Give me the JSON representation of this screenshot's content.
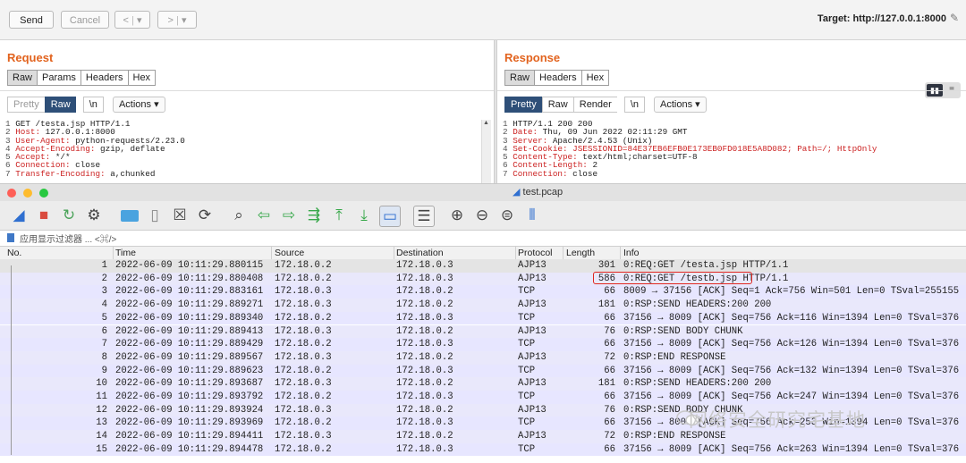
{
  "burp": {
    "buttons": {
      "send": "Send",
      "cancel": "Cancel",
      "back": "<",
      "forward": ">",
      "dropdown": "▾"
    },
    "target_label": "Target: http://127.0.0.1:8000",
    "request": {
      "title": "Request",
      "tabs": [
        "Raw",
        "Params",
        "Headers",
        "Hex"
      ],
      "subtabs": {
        "pretty": "Pretty",
        "raw": "Raw",
        "newline": "\\n",
        "actions": "Actions ▾"
      },
      "lines": [
        {
          "n": "1",
          "k": "",
          "v": "GET /testa.jsp HTTP/1.1"
        },
        {
          "n": "2",
          "k": "Host:",
          "v": " 127.0.0.1:8000"
        },
        {
          "n": "3",
          "k": "User-Agent:",
          "v": " python-requests/2.23.0"
        },
        {
          "n": "4",
          "k": "Accept-Encoding:",
          "v": " gzip, deflate"
        },
        {
          "n": "5",
          "k": "Accept:",
          "v": " */*"
        },
        {
          "n": "6",
          "k": "Connection:",
          "v": " close"
        },
        {
          "n": "7",
          "k": "Transfer-Encoding:",
          "v": " a,chunked"
        }
      ]
    },
    "response": {
      "title": "Response",
      "tabs": [
        "Raw",
        "Headers",
        "Hex"
      ],
      "subtabs": {
        "pretty": "Pretty",
        "raw": "Raw",
        "render": "Render",
        "newline": "\\n",
        "actions": "Actions ▾"
      },
      "lines": [
        {
          "n": "1",
          "k": "",
          "v": "HTTP/1.1 200 200"
        },
        {
          "n": "2",
          "k": "Date:",
          "v": " Thu, 09 Jun 2022 02:11:29 GMT"
        },
        {
          "n": "3",
          "k": "Server:",
          "v": " Apache/2.4.53 (Unix)"
        },
        {
          "n": "4",
          "k": "Set-Cookie:",
          "v": " JSESSIONID=84E37EB6EFB0E173EB0FD018E5A8D082; Path=/; HttpOnly"
        },
        {
          "n": "5",
          "k": "Content-Type:",
          "v": " text/html;charset=UTF-8"
        },
        {
          "n": "6",
          "k": "Content-Length:",
          "v": " 2"
        },
        {
          "n": "7",
          "k": "Connection:",
          "v": " close"
        }
      ]
    }
  },
  "wireshark": {
    "title": "test.pcap",
    "filter_placeholder": "应用显示过滤器 ... <⌘/>",
    "columns": [
      "No.",
      "Time",
      "Source",
      "Destination",
      "Protocol",
      "Length",
      "Info"
    ],
    "packets": [
      {
        "no": "1",
        "time": "2022-06-09 10:11:29.880115",
        "src": "172.18.0.2",
        "dst": "172.18.0.3",
        "proto": "AJP13",
        "len": "301",
        "info": "0:REQ:GET /testa.jsp HTTP/1.1"
      },
      {
        "no": "2",
        "time": "2022-06-09 10:11:29.880408",
        "src": "172.18.0.2",
        "dst": "172.18.0.3",
        "proto": "AJP13",
        "len": "586",
        "info": "0:REQ:GET /testb.jsp HTTP/1.1"
      },
      {
        "no": "3",
        "time": "2022-06-09 10:11:29.883161",
        "src": "172.18.0.3",
        "dst": "172.18.0.2",
        "proto": "TCP",
        "len": "66",
        "info": "8009 → 37156 [ACK] Seq=1 Ack=756 Win=501 Len=0 TSval=255155"
      },
      {
        "no": "4",
        "time": "2022-06-09 10:11:29.889271",
        "src": "172.18.0.3",
        "dst": "172.18.0.2",
        "proto": "AJP13",
        "len": "181",
        "info": "0:RSP:SEND HEADERS:200 200"
      },
      {
        "no": "5",
        "time": "2022-06-09 10:11:29.889340",
        "src": "172.18.0.2",
        "dst": "172.18.0.3",
        "proto": "TCP",
        "len": "66",
        "info": "37156 → 8009 [ACK] Seq=756 Ack=116 Win=1394 Len=0 TSval=376"
      },
      {
        "no": "6",
        "time": "2022-06-09 10:11:29.889413",
        "src": "172.18.0.3",
        "dst": "172.18.0.2",
        "proto": "AJP13",
        "len": "76",
        "info": "0:RSP:SEND BODY CHUNK"
      },
      {
        "no": "7",
        "time": "2022-06-09 10:11:29.889429",
        "src": "172.18.0.2",
        "dst": "172.18.0.3",
        "proto": "TCP",
        "len": "66",
        "info": "37156 → 8009 [ACK] Seq=756 Ack=126 Win=1394 Len=0 TSval=376"
      },
      {
        "no": "8",
        "time": "2022-06-09 10:11:29.889567",
        "src": "172.18.0.3",
        "dst": "172.18.0.2",
        "proto": "AJP13",
        "len": "72",
        "info": "0:RSP:END RESPONSE"
      },
      {
        "no": "9",
        "time": "2022-06-09 10:11:29.889623",
        "src": "172.18.0.2",
        "dst": "172.18.0.3",
        "proto": "TCP",
        "len": "66",
        "info": "37156 → 8009 [ACK] Seq=756 Ack=132 Win=1394 Len=0 TSval=376"
      },
      {
        "no": "10",
        "time": "2022-06-09 10:11:29.893687",
        "src": "172.18.0.3",
        "dst": "172.18.0.2",
        "proto": "AJP13",
        "len": "181",
        "info": "0:RSP:SEND HEADERS:200 200"
      },
      {
        "no": "11",
        "time": "2022-06-09 10:11:29.893792",
        "src": "172.18.0.2",
        "dst": "172.18.0.3",
        "proto": "TCP",
        "len": "66",
        "info": "37156 → 8009 [ACK] Seq=756 Ack=247 Win=1394 Len=0 TSval=376"
      },
      {
        "no": "12",
        "time": "2022-06-09 10:11:29.893924",
        "src": "172.18.0.3",
        "dst": "172.18.0.2",
        "proto": "AJP13",
        "len": "76",
        "info": "0:RSP:SEND BODY CHUNK"
      },
      {
        "no": "13",
        "time": "2022-06-09 10:11:29.893969",
        "src": "172.18.0.2",
        "dst": "172.18.0.3",
        "proto": "TCP",
        "len": "66",
        "info": "37156 → 8009 [ACK] Seq=756 Ack=253 Win=1394 Len=0 TSval=376"
      },
      {
        "no": "14",
        "time": "2022-06-09 10:11:29.894411",
        "src": "172.18.0.3",
        "dst": "172.18.0.2",
        "proto": "AJP13",
        "len": "72",
        "info": "0:RSP:END RESPONSE"
      },
      {
        "no": "15",
        "time": "2022-06-09 10:11:29.894478",
        "src": "172.18.0.2",
        "dst": "172.18.0.3",
        "proto": "TCP",
        "len": "66",
        "info": "37156 → 8009 [ACK] Seq=756 Ack=263 Win=1394 Len=0 TSval=376"
      }
    ]
  },
  "watermark": "网络安全研究宅基地",
  "colors": {
    "accent_orange": "#e2631e",
    "header_key_red": "#cc2222",
    "selected_tab_blue": "#2e4f78",
    "highlight_red": "#e0261f"
  }
}
